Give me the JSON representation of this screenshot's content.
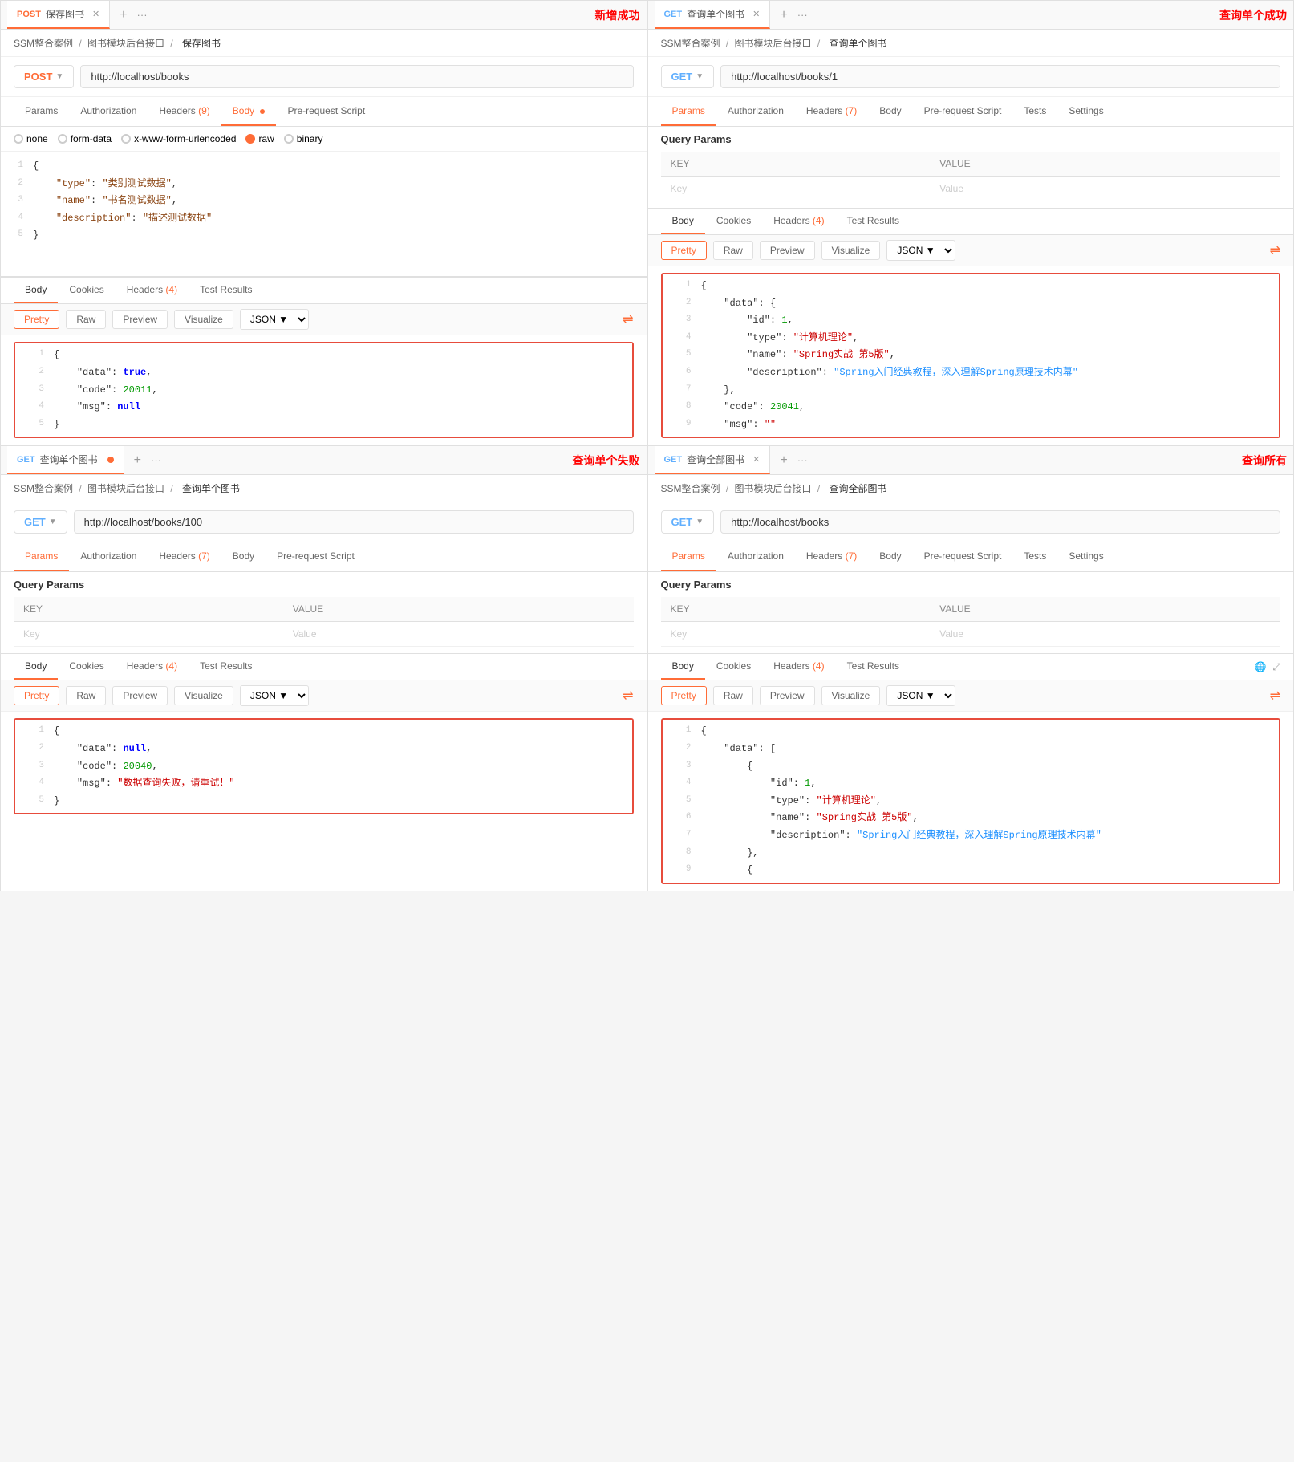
{
  "panels": [
    {
      "id": "panel-post-save",
      "tab": {
        "method": "POST",
        "method_class": "post",
        "title": "保存图书",
        "has_close": true,
        "success_label": "新增成功",
        "success_class": "red-text"
      },
      "breadcrumb": {
        "parts": [
          "SSM整合案例",
          "图书模块后台接口"
        ],
        "current": "保存图书"
      },
      "url": {
        "method": "POST",
        "method_class": "post",
        "value": "http://localhost/books"
      },
      "nav_tabs": [
        {
          "label": "Params",
          "active": false
        },
        {
          "label": "Authorization",
          "active": false
        },
        {
          "label": "Headers",
          "badge": "9",
          "active": false
        },
        {
          "label": "Body",
          "dot": true,
          "active": true
        },
        {
          "label": "Pre-request Script",
          "active": false
        }
      ],
      "body_types": [
        {
          "label": "none",
          "checked": false
        },
        {
          "label": "form-data",
          "checked": false
        },
        {
          "label": "x-www-form-urlencoded",
          "checked": false
        },
        {
          "label": "raw",
          "checked": true
        },
        {
          "label": "binary",
          "checked": false
        }
      ],
      "request_body": [
        {
          "num": 1,
          "content": "{"
        },
        {
          "num": 2,
          "content": "    \"type\": \"类别测试数据\","
        },
        {
          "num": 3,
          "content": "    \"name\": \"书名测试数据\","
        },
        {
          "num": 4,
          "content": "    \"description\": \"描述测试数据\""
        },
        {
          "num": 5,
          "content": "}"
        }
      ],
      "response_tabs": [
        {
          "label": "Body",
          "active": true
        },
        {
          "label": "Cookies",
          "active": false
        },
        {
          "label": "Headers",
          "badge": "4",
          "active": false
        },
        {
          "label": "Test Results",
          "active": false
        }
      ],
      "response_body": [
        {
          "num": 1,
          "content": "{"
        },
        {
          "num": 2,
          "content": "    \"data\": true,",
          "highlight_key": "data",
          "highlight_val": "true",
          "val_class": "j-val-true"
        },
        {
          "num": 3,
          "content": "    \"code\": 20011,",
          "highlight_key": "code",
          "highlight_num": "20011"
        },
        {
          "num": 4,
          "content": "    \"msg\": null",
          "highlight_key": "msg",
          "highlight_val": "null",
          "val_class": "j-val-null"
        },
        {
          "num": 5,
          "content": "}"
        }
      ]
    },
    {
      "id": "panel-get-single-success",
      "tab": {
        "method": "GET",
        "method_class": "get",
        "title": "查询单个图书",
        "has_close": true,
        "success_label": "查询单个成功",
        "success_class": "red-text"
      },
      "breadcrumb": {
        "parts": [
          "SSM整合案例",
          "图书模块后台接口"
        ],
        "current": "查询单个图书"
      },
      "url": {
        "method": "GET",
        "method_class": "get",
        "value": "http://localhost/books/1"
      },
      "nav_tabs": [
        {
          "label": "Params",
          "active": true
        },
        {
          "label": "Authorization",
          "active": false
        },
        {
          "label": "Headers",
          "badge": "7",
          "active": false
        },
        {
          "label": "Body",
          "active": false
        },
        {
          "label": "Pre-request Script",
          "active": false
        },
        {
          "label": "Tests",
          "active": false
        },
        {
          "label": "Settings",
          "active": false
        }
      ],
      "query_params": {
        "title": "Query Params",
        "columns": [
          "KEY",
          "VALUE"
        ],
        "rows": [
          {
            "key": "Key",
            "value": "Value",
            "placeholder": true
          }
        ]
      },
      "response_tabs": [
        {
          "label": "Body",
          "active": true
        },
        {
          "label": "Cookies",
          "active": false
        },
        {
          "label": "Headers",
          "badge": "4",
          "active": false
        },
        {
          "label": "Test Results",
          "active": false
        }
      ],
      "response_body_lines": [
        {
          "num": 1,
          "content": "{"
        },
        {
          "num": 2,
          "content": "    \"data\": {"
        },
        {
          "num": 3,
          "content": "        \"id\": 1,"
        },
        {
          "num": 4,
          "content": "        \"type\": \"计算机理论\","
        },
        {
          "num": 5,
          "content": "        \"name\": \"Spring实战 第5版\","
        },
        {
          "num": 6,
          "content": "        \"description\": \"Spring入门经典教程，深入理解Spring原理技术内幕\""
        },
        {
          "num": 7,
          "content": "    },"
        },
        {
          "num": 8,
          "content": "    \"code\": 20041,"
        },
        {
          "num": 9,
          "content": "    \"msg\": \"\""
        }
      ]
    },
    {
      "id": "panel-get-single-fail",
      "tab": {
        "method": "GET",
        "method_class": "get",
        "title": "查询单个图书",
        "has_close": false,
        "dot": true,
        "success_label": "查询单个失败",
        "success_class": "red-text"
      },
      "breadcrumb": {
        "parts": [
          "SSM整合案例",
          "图书模块后台接口"
        ],
        "current": "查询单个图书"
      },
      "url": {
        "method": "GET",
        "method_class": "get",
        "value": "http://localhost/books/100"
      },
      "nav_tabs": [
        {
          "label": "Params",
          "active": true
        },
        {
          "label": "Authorization",
          "active": false
        },
        {
          "label": "Headers",
          "badge": "7",
          "active": false
        },
        {
          "label": "Body",
          "active": false
        },
        {
          "label": "Pre-request Script",
          "active": false
        }
      ],
      "query_params": {
        "title": "Query Params",
        "columns": [
          "KEY",
          "VALUE"
        ],
        "rows": [
          {
            "key": "Key",
            "value": "Value",
            "placeholder": true
          }
        ]
      },
      "response_tabs": [
        {
          "label": "Body",
          "active": true
        },
        {
          "label": "Cookies",
          "active": false
        },
        {
          "label": "Headers",
          "badge": "4",
          "active": false
        },
        {
          "label": "Test Results",
          "active": false
        }
      ],
      "response_body_lines": [
        {
          "num": 1,
          "content": "{"
        },
        {
          "num": 2,
          "content": "    \"data\": null,"
        },
        {
          "num": 3,
          "content": "    \"code\": 20040,"
        },
        {
          "num": 4,
          "content": "    \"msg\": \"数据查询失败，请重试！\""
        },
        {
          "num": 5,
          "content": "}"
        }
      ]
    },
    {
      "id": "panel-get-all",
      "tab": {
        "method": "GET",
        "method_class": "get",
        "title": "查询全部图书",
        "has_close": true,
        "has_add": true,
        "success_label": "查询所有",
        "success_class": "red-text"
      },
      "breadcrumb": {
        "parts": [
          "SSM整合案例",
          "图书模块后台接口"
        ],
        "current": "查询全部图书"
      },
      "url": {
        "method": "GET",
        "method_class": "get",
        "value": "http://localhost/books"
      },
      "nav_tabs": [
        {
          "label": "Params",
          "active": true
        },
        {
          "label": "Authorization",
          "active": false
        },
        {
          "label": "Headers",
          "badge": "7",
          "active": false
        },
        {
          "label": "Body",
          "active": false
        },
        {
          "label": "Pre-request Script",
          "active": false
        },
        {
          "label": "Tests",
          "active": false
        },
        {
          "label": "Settings",
          "active": false
        }
      ],
      "query_params": {
        "title": "Query Params",
        "columns": [
          "KEY",
          "VALUE"
        ],
        "rows": [
          {
            "key": "Key",
            "value": "Value",
            "placeholder": true
          }
        ]
      },
      "response_tabs": [
        {
          "label": "Body",
          "active": true
        },
        {
          "label": "Cookies",
          "active": false
        },
        {
          "label": "Headers",
          "badge": "4",
          "active": false
        },
        {
          "label": "Test Results",
          "active": false
        }
      ],
      "response_body_lines": [
        {
          "num": 1,
          "content": "{"
        },
        {
          "num": 2,
          "content": "    \"data\": ["
        },
        {
          "num": 3,
          "content": "        {"
        },
        {
          "num": 4,
          "content": "            \"id\": 1,"
        },
        {
          "num": 5,
          "content": "            \"type\": \"计算机理论\","
        },
        {
          "num": 6,
          "content": "            \"name\": \"Spring实战 第5版\","
        },
        {
          "num": 7,
          "content": "            \"description\": \"Spring入门经典教程，深入理解Spring原理技术内幕\""
        },
        {
          "num": 8,
          "content": "        },"
        },
        {
          "num": 9,
          "content": "        {"
        }
      ]
    }
  ],
  "labels": {
    "pretty": "Pretty",
    "raw": "Raw",
    "preview": "Preview",
    "visualize": "Visualize",
    "json": "JSON",
    "body": "Body",
    "cookies": "Cookies",
    "test_results": "Test Results",
    "query_params": "Query Params",
    "key": "KEY",
    "value": "VALUE",
    "key_placeholder": "Key",
    "value_placeholder": "Value"
  }
}
